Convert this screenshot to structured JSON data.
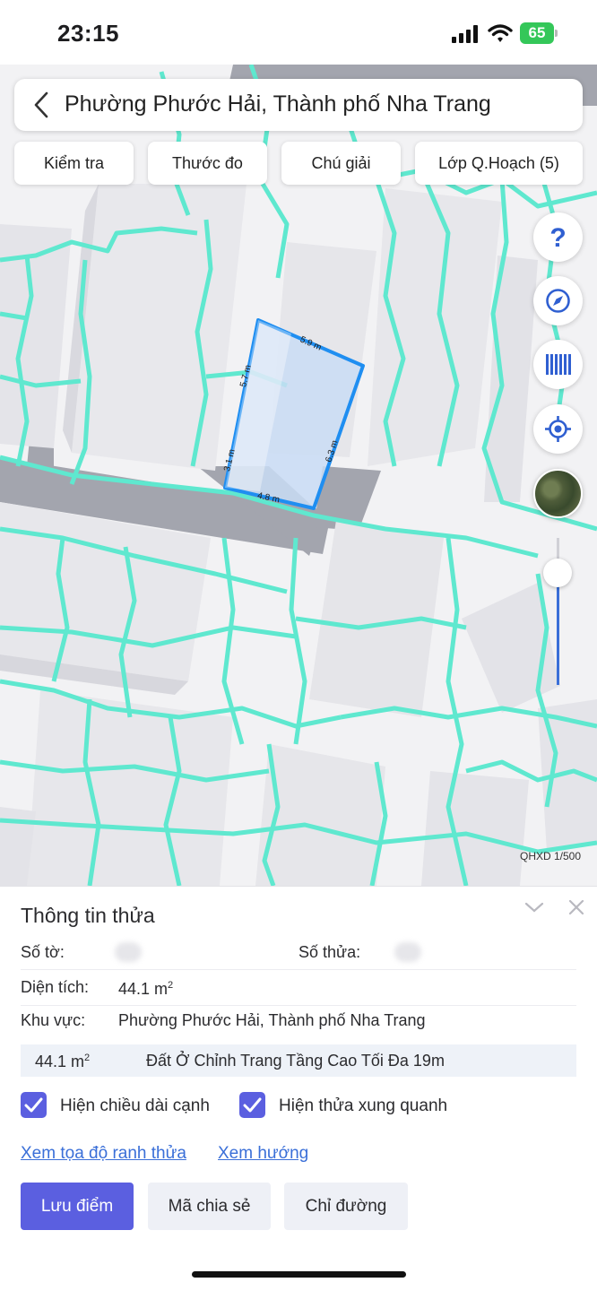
{
  "status_bar": {
    "time": "23:15",
    "battery": "65",
    "icons": [
      "signal-icon",
      "wifi-icon",
      "battery-icon"
    ]
  },
  "search_bar": {
    "title": "Phường Phước Hải, Thành phố Nha Trang",
    "back_icon": "chevron-left-icon"
  },
  "toolbar": {
    "chips": [
      "Kiểm tra",
      "Thước đo",
      "Chú giải",
      "Lớp Q.Hoạch (5)"
    ]
  },
  "map_controls": {
    "buttons": [
      "help-icon",
      "compass-icon",
      "barcode-icon",
      "locate-icon",
      "satellite-layer-icon"
    ],
    "zoom_level_fraction": 0.24
  },
  "map": {
    "scale_label": "QHXD 1/500",
    "parcel_edges": [
      "5.9 m",
      "6.3 m",
      "4.8 m",
      "3.1 m",
      "5.7 m"
    ],
    "colors": {
      "parcel_outline": "#1f8ef1",
      "parcel_fill": "#c9dcf4",
      "plan_lines": "#5fe8cf",
      "buildings": "#e6e6ea",
      "roads": "#9a9ca6"
    }
  },
  "panel": {
    "title": "Thông tin thửa",
    "so_to_label": "Số tờ:",
    "so_thua_label": "Số thửa:",
    "dien_tich_label": "Diện tích:",
    "dien_tich_value": "44.1 m",
    "area_unit_exponent": "2",
    "khu_vuc_label": "Khu vực:",
    "khu_vuc_value": "Phường Phước Hải, Thành phố Nha Trang",
    "zone": {
      "area": "44.1 m",
      "name": "Đất Ở Chỉnh Trang Tầng Cao Tối Đa 19m"
    },
    "checkboxes": [
      {
        "label": "Hiện chiều dài cạnh",
        "checked": true
      },
      {
        "label": "Hiện thửa xung quanh",
        "checked": true
      }
    ],
    "links": [
      "Xem tọa độ ranh thửa",
      "Xem hướng"
    ],
    "buttons": {
      "save": "Lưu điểm",
      "share": "Mã chia sẻ",
      "directions": "Chỉ đường"
    },
    "colors": {
      "accent": "#5b5fe0",
      "link": "#3a6fd8"
    }
  }
}
